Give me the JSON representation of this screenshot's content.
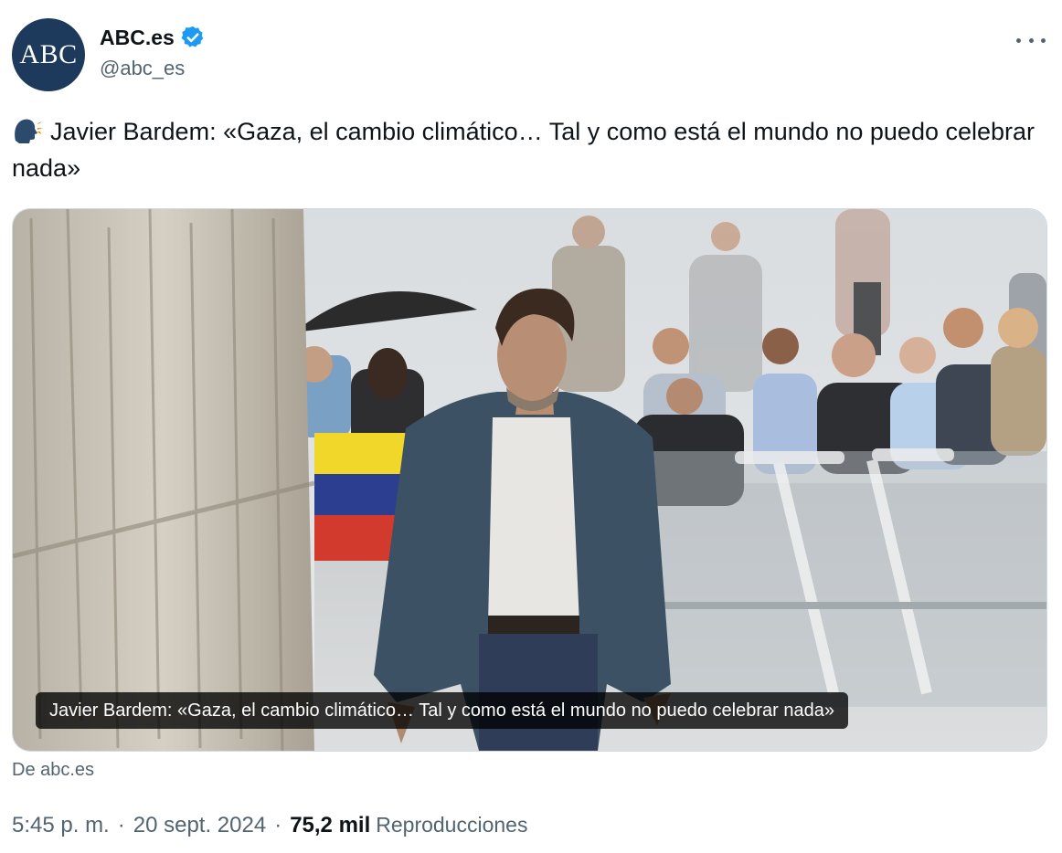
{
  "author": {
    "avatar_text": "ABC",
    "display_name": "ABC.es",
    "handle": "@abc_es",
    "verified": true,
    "accent_color": "#1d9bf0"
  },
  "tweet": {
    "emoji": "speaking-head",
    "text": "Javier Bardem: «Gaza, el cambio climático… Tal y como está el mundo no puedo celebrar nada»"
  },
  "card": {
    "caption": "Javier Bardem: «Gaza, el cambio climático… Tal y como está el mundo no puedo celebrar nada»",
    "source": "De abc.es"
  },
  "meta": {
    "time": "5:45 p. m.",
    "sep1": "·",
    "date": "20 sept. 2024",
    "sep2": "·",
    "views": "75,2 mil",
    "views_label": "Reproducciones"
  }
}
